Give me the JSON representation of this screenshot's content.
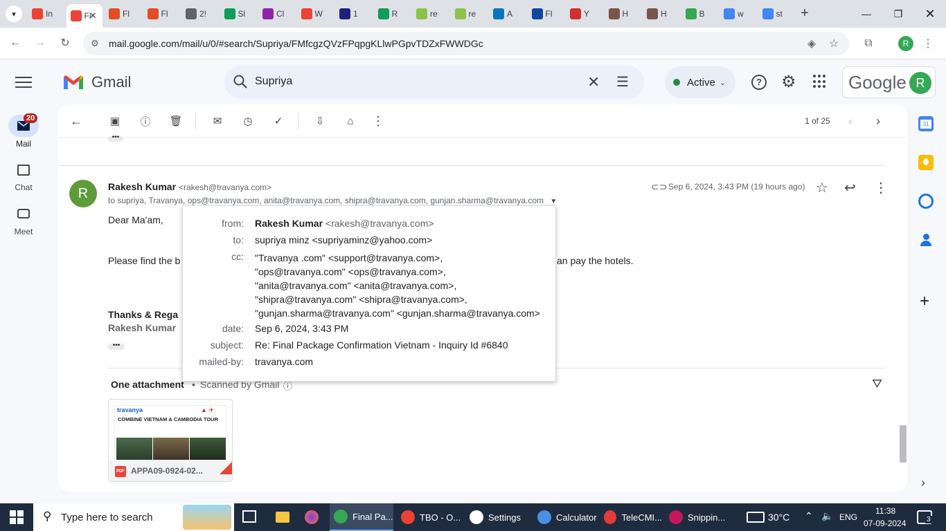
{
  "browser": {
    "tabs": [
      {
        "label": "In",
        "color": "#ea4335"
      },
      {
        "label": "Fi",
        "color": "#ea4335",
        "active": true
      },
      {
        "label": "Fl",
        "color": "#e34c26"
      },
      {
        "label": "Fl",
        "color": "#e34c26"
      },
      {
        "label": "2!",
        "color": "#5f6368"
      },
      {
        "label": "Sl",
        "color": "#0f9d58"
      },
      {
        "label": "Cl",
        "color": "#8e24aa"
      },
      {
        "label": "W",
        "color": "#ea4335"
      },
      {
        "label": "1",
        "color": "#1a237e"
      },
      {
        "label": "R",
        "color": "#0f9d58"
      },
      {
        "label": "re",
        "color": "#8bc34a"
      },
      {
        "label": "re",
        "color": "#8bc34a"
      },
      {
        "label": "A",
        "color": "#0277bd"
      },
      {
        "label": "Fl",
        "color": "#0d47a1"
      },
      {
        "label": "Y",
        "color": "#d32f2f"
      },
      {
        "label": "H",
        "color": "#795548"
      },
      {
        "label": "H",
        "color": "#795548"
      },
      {
        "label": "B",
        "color": "#34a853"
      },
      {
        "label": "w",
        "color": "#4285f4"
      },
      {
        "label": "st",
        "color": "#4285f4"
      }
    ],
    "url": "mail.google.com/mail/u/0/#search/Supriya/FMfcgzQVzFPqpgKLlwPGpvTDZxFWWDGc",
    "profile_initial": "R"
  },
  "gmail": {
    "product_name": "Gmail",
    "search_value": "Supriya",
    "status": "Active",
    "google_label": "Google",
    "account_initial": "R",
    "rail": {
      "mail_label": "Mail",
      "mail_badge": "20",
      "chat_label": "Chat",
      "meet_label": "Meet"
    },
    "pagination": "1 of 25"
  },
  "message": {
    "sender_name": "Rakesh Kumar",
    "sender_email": "<rakesh@travanya.com>",
    "avatar_initial": "R",
    "recipients": "to supriya, Travanya, ops@travanya.com, anita@travanya.com, shipra@travanya.com, gunjan.sharma@travanya.com",
    "date_text": "Sep 6, 2024, 3:43 PM (19 hours ago)",
    "greeting": "Dear Ma'am,",
    "line_start": "Please find the b",
    "line_end": "an pay the hotels.",
    "signoff": "Thanks & Rega",
    "signature": "Rakesh Kumar",
    "attachment_heading": "One attachment",
    "scanned": "Scanned by Gmail",
    "attachment_name": "APPA09-0924-02...",
    "attachment_thumb_brand": "travanya",
    "attachment_thumb_title": "COMBINE VIETNAM & CAMBODIA TOUR",
    "pdf_label": "PDF"
  },
  "popup": {
    "from_label": "from:",
    "from_name": "Rakesh Kumar",
    "from_email": "<rakesh@travanya.com>",
    "to_label": "to:",
    "to_value": "supriya minz <supriyaminz@yahoo.com>",
    "cc_label": "cc:",
    "cc_lines": [
      "\"Travanya .com\" <support@travanya.com>,",
      "\"ops@travanya.com\" <ops@travanya.com>,",
      "\"anita@travanya.com\" <anita@travanya.com>,",
      "\"shipra@travanya.com\" <shipra@travanya.com>,",
      "\"gunjan.sharma@travanya.com\" <gunjan.sharma@travanya.com>"
    ],
    "date_label": "date:",
    "date_value": "Sep 6, 2024, 3:43 PM",
    "subject_label": "subject:",
    "subject_value": "Re: Final Package Confirmation Vietnam - Inquiry Id #6840",
    "mailedby_label": "mailed-by:",
    "mailedby_value": "travanya.com"
  },
  "taskbar": {
    "search_placeholder": "Type here to search",
    "apps": [
      {
        "label": "Final Pa...",
        "color": "#34a853"
      },
      {
        "label": "TBO - O...",
        "color": "#ea4335"
      },
      {
        "label": "Settings",
        "color": "#ffffff"
      },
      {
        "label": "Calculator",
        "color": "#4a90e2"
      },
      {
        "label": "TeleCMI...",
        "color": "#e53935"
      },
      {
        "label": "Snippin...",
        "color": "#c2185b"
      }
    ],
    "temperature": "30°C",
    "language": "ENG",
    "time": "11:38",
    "date": "07-09-2024",
    "notifications": "3"
  }
}
